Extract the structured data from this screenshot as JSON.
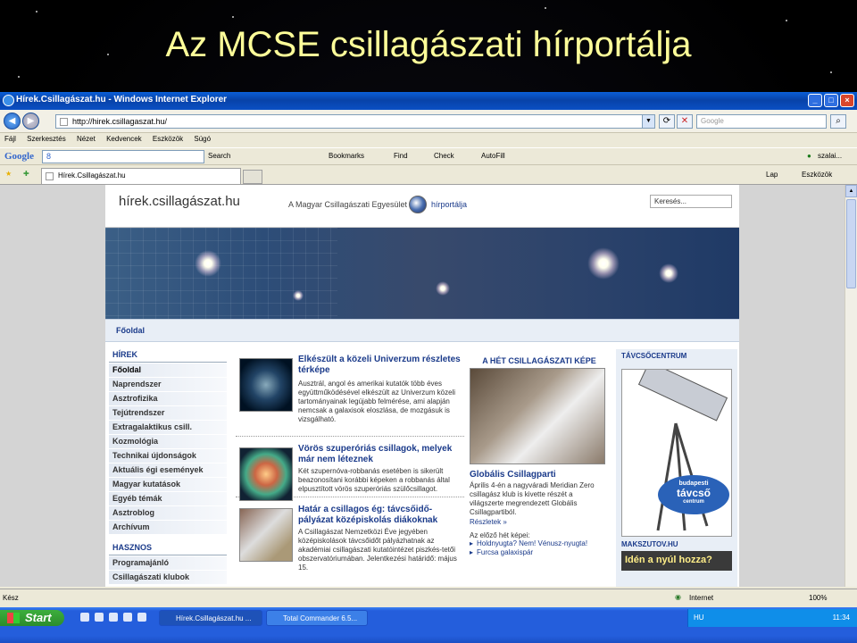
{
  "slide": {
    "title": "Az MCSE csillagászati hírportálja"
  },
  "window": {
    "title": "Hírek.Csillagászat.hu - Windows Internet Explorer"
  },
  "address": {
    "url": "http://hirek.csillagaszat.hu/",
    "search_placeholder": "Google"
  },
  "menu": [
    "Fájl",
    "Szerkesztés",
    "Nézet",
    "Kedvencek",
    "Eszközök",
    "Súgó"
  ],
  "gtoolbar": {
    "logo": "Google",
    "box_value": "8",
    "search": "Search",
    "bookmarks": "Bookmarks",
    "find": "Find",
    "check": "Check",
    "autofill": "AutoFill",
    "user": "szalai..."
  },
  "tab": {
    "label": "Hírek.Csillagászat.hu",
    "lap": "Lap",
    "tools": "Eszközök"
  },
  "site": {
    "logo": "hírek.csillagászat.hu",
    "tagline": "A Magyar Csillagászati Egyesület",
    "portal": "hírportálja",
    "search_value": "Keresés...",
    "breadcrumb": "Főoldal",
    "nav": {
      "head1": "HÍREK",
      "items1": [
        "Főoldal",
        "Naprendszer",
        "Asztrofizika",
        "Tejútrendszer",
        "Extragalaktikus csill.",
        "Kozmológia",
        "Technikai újdonságok",
        "Aktuális égi események",
        "Magyar kutatások",
        "Egyéb témák",
        "Asztroblog",
        "Archívum"
      ],
      "head2": "HASZNOS",
      "items2": [
        "Programajánló",
        "Csillagászati klubok"
      ]
    },
    "stories": [
      {
        "title": "Elkészült a közeli Univerzum részletes térképe",
        "text": "Ausztrál, angol és amerikai kutatók több éves együttműködésével elkészült az Univerzum közeli tartományainak legújabb felmérése, ami alapján nemcsak a galaxisok eloszlása, de mozgásuk is vizsgálható."
      },
      {
        "title": "Vörös szuperóriás csillagok, melyek már nem léteznek",
        "text": "Két szupernóva-robbanás esetében is sikerült beazonosítani korábbi képeken a robbanás által elpusztított vörös szuperóriás szülőcsillagot."
      },
      {
        "title": "Határ a csillagos ég: távcsőidő-pályázat középiskolás diákoknak",
        "text": "A Csillagászat Nemzetközi Éve jegyében középiskolások távcsőidőt pályázhatnak az akadémiai csillagászati kutatóintézet piszkés-tetői obszervatóriumában. Jelentkezési határidő: május 15."
      }
    ],
    "week": {
      "head": "A HÉT CSILLAGÁSZATI KÉPE",
      "title": "Globális Csillagparti",
      "text": "Április 4-én a nagyváradi Meridian Zero csillagász klub is kivette részét a világszerte megrendezett Globális Csillagpartiból.",
      "more": "Részletek »",
      "prev": "Az előző hét képei:",
      "prev_items": [
        "Holdnyugta? Nem! Vénusz-nyugta!",
        "Furcsa galaxispár"
      ]
    },
    "right": {
      "head1": "TÁVCSŐCENTRUM",
      "badge_small": "budapesti",
      "badge_big": "távcső",
      "badge_sub": "centrum",
      "head2": "MAKSZUTOV.HU",
      "promo": "Idén a nyúl hozza?"
    }
  },
  "status": {
    "text": "Kész",
    "zone": "Internet",
    "zoom": "100%"
  },
  "taskbar": {
    "start": "Start",
    "btn1": "Hírek.Csillagászat.hu ...",
    "btn2": "Total Commander 6.5...",
    "lang": "HU",
    "clock": "11:34"
  },
  "colors": {
    "slide_title": "#ffff99",
    "link": "#1a3a8a",
    "titlebar": "#0a5fd8",
    "taskbar": "#245edc"
  }
}
